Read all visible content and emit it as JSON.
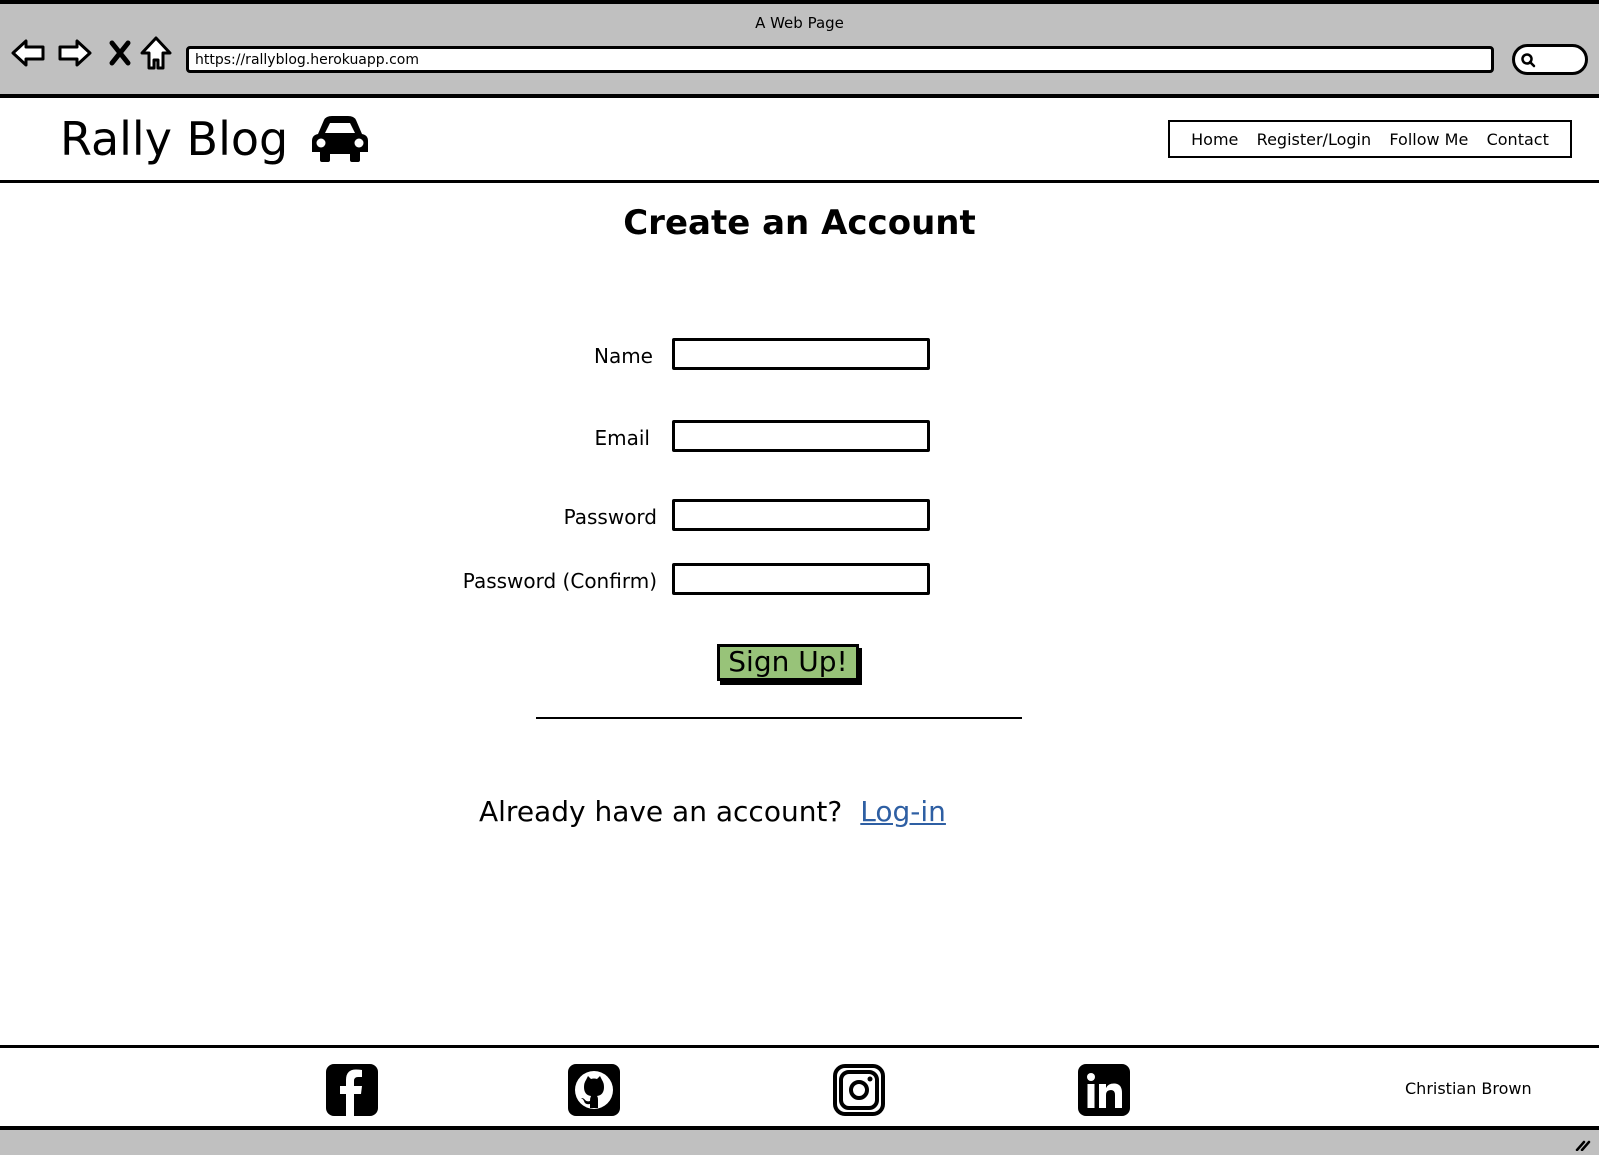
{
  "browser": {
    "window_title": "A Web Page",
    "url": "https://rallyblog.herokuapp.com",
    "nav_icons": [
      "back-arrow-icon",
      "forward-arrow-icon",
      "stop-icon",
      "home-icon"
    ],
    "search_icon": "search-icon"
  },
  "header": {
    "logo_text": "Rally Blog",
    "logo_icon": "car-icon",
    "nav": [
      {
        "label": "Home"
      },
      {
        "label": "Register/Login"
      },
      {
        "label": "Follow Me"
      },
      {
        "label": "Contact"
      }
    ]
  },
  "main": {
    "title": "Create an Account",
    "fields": [
      {
        "label": "Name",
        "value": "",
        "placeholder": ""
      },
      {
        "label": "Email",
        "value": "",
        "placeholder": ""
      },
      {
        "label": "Password",
        "value": "",
        "placeholder": ""
      },
      {
        "label": "Password (Confirm)",
        "value": "",
        "placeholder": ""
      }
    ],
    "submit_label": "Sign Up!",
    "submit_color": "#98c379",
    "login_prompt": "Already have an account?",
    "login_link": "Log-in",
    "link_color": "#2e5fa3"
  },
  "footer": {
    "social": [
      {
        "name": "facebook-icon"
      },
      {
        "name": "github-icon"
      },
      {
        "name": "instagram-icon"
      },
      {
        "name": "linkedin-icon"
      }
    ],
    "author": "Christian Brown"
  }
}
